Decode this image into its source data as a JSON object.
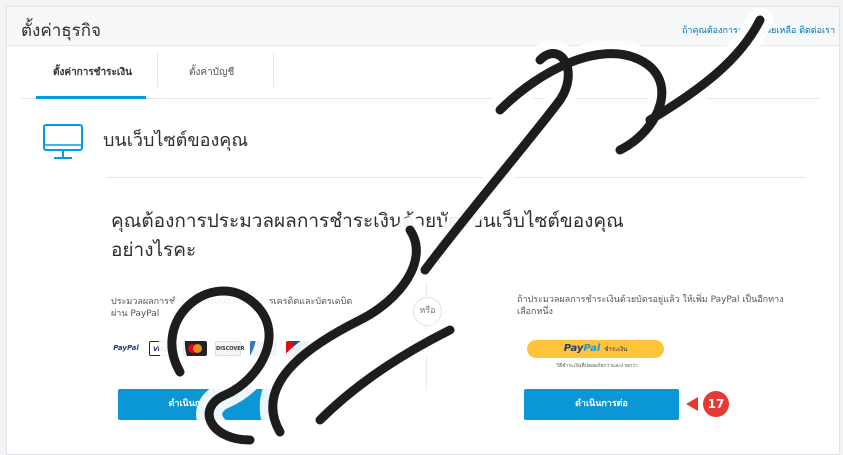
{
  "header": {
    "title": "ตั้งค่าธุรกิจ",
    "help_link": "ถ้าคุณต้องการความช่วยเหลือ ติดต่อเรา"
  },
  "tabs": [
    {
      "label": "ตั้งค่าการชำระเงิน",
      "active": true
    },
    {
      "label": "ตั้งค่าบัญชี",
      "active": false
    }
  ],
  "section": {
    "icon": "monitor-icon",
    "title": "บนเว็บไซต์ของคุณ",
    "question_line1": "คุณต้องการประมวลผลการชำระเงินด้วยบัตรบนเว็บไซต์ของคุณ",
    "question_line2": "อย่างไรคะ"
  },
  "options": {
    "left": {
      "description": "ประมวลผลการชำระเงินทั้งหมดรวมถึงบัตรเครดิตและบัตรเดบิต ผ่าน PayPal",
      "card_logos": [
        "PayPal",
        "VISA",
        "MasterCard",
        "DISCOVER",
        "AMEX",
        "UnionPay"
      ],
      "button_label": "ดำเนินการต่อ"
    },
    "divider_label": "หรือ",
    "right": {
      "description": "ถ้าประมวลผลการชำระเงินด้วยบัตรอยู่แล้ว ให้เพิ่ม PayPal เป็นอีกทางเลือกหนึ่ง",
      "paypal_button": {
        "brand_part1": "Pay",
        "brand_part2": "Pal",
        "label": "ชำระเงิน"
      },
      "paypal_subtext": "วิธีชำระเงินที่ปลอดภัยกว่าและง่ายกว่า",
      "button_label": "ดำเนินการต่อ"
    }
  },
  "annotation": {
    "step_number": "17",
    "color": "#e53935"
  },
  "colors": {
    "accent": "#009cde",
    "button": "#0b97d5",
    "paypal_yellow": "#ffc439",
    "link": "#0070ba"
  }
}
